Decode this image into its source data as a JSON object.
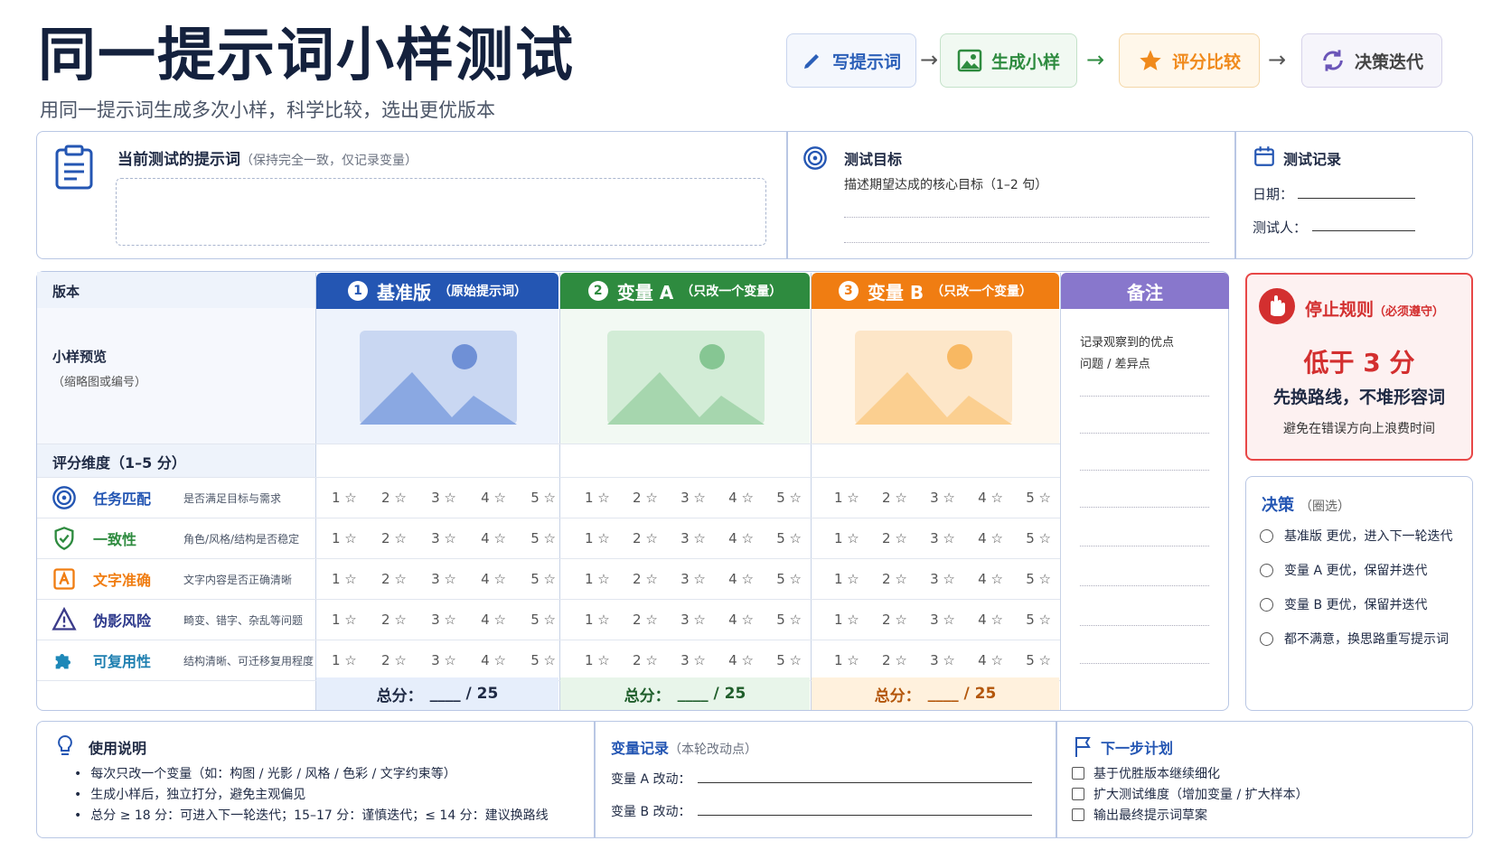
{
  "header": {
    "title": "同一提示词小样测试",
    "subtitle": "用同一提示词生成多次小样，科学比较，选出更优版本",
    "steps": [
      {
        "label": "写提示词",
        "icon": "pencil-icon",
        "color": "#2b5fb8"
      },
      {
        "label": "生成小样",
        "icon": "image-icon",
        "color": "#2e8b3f"
      },
      {
        "label": "评分比较",
        "icon": "star-icon",
        "color": "#f08a1c"
      },
      {
        "label": "决策迭代",
        "icon": "refresh-icon",
        "color": "#6b55b8"
      }
    ],
    "arrow": "→"
  },
  "prompt_box": {
    "title": "当前测试的提示词",
    "hint": "（保持完全一致，仅记录变量）"
  },
  "goal_box": {
    "title": "测试目标",
    "desc": "描述期望达成的核心目标（1–2 句）"
  },
  "record_box": {
    "title": "测试记录",
    "date_label": "日期：",
    "tester_label": "测试人："
  },
  "table": {
    "version_label": "版本",
    "preview_label": "小样预览",
    "preview_hint": "（缩略图或编号）",
    "score_dim_label": "评分维度（1–5 分）",
    "columns": [
      {
        "num": "1",
        "name": "基准版",
        "note": "（原始提示词）",
        "color": "#2456b3"
      },
      {
        "num": "2",
        "name": "变量 A",
        "note": "（只改一个变量）",
        "color": "#2e8b3f"
      },
      {
        "num": "3",
        "name": "变量 B",
        "note": "（只改一个变量）",
        "color": "#f07d12"
      }
    ],
    "notes_header": "备注",
    "notes_text1": "记录观察到的优点",
    "notes_text2": "问题 / 差异点",
    "criteria": [
      {
        "name": "任务匹配",
        "desc": "是否满足目标与需求",
        "icon": "target-icon"
      },
      {
        "name": "一致性",
        "desc": "角色/风格/结构是否稳定",
        "icon": "shield-check-icon"
      },
      {
        "name": "文字准确",
        "desc": "文字内容是否正确清晰",
        "icon": "text-box-icon"
      },
      {
        "name": "伪影风险",
        "desc": "畸变、错字、杂乱等问题",
        "icon": "warning-icon"
      },
      {
        "name": "可复用性",
        "desc": "结构清晰、可迁移复用程度",
        "icon": "puzzle-icon"
      }
    ],
    "star_options": [
      "1 ☆",
      "2 ☆",
      "3 ☆",
      "4 ☆",
      "5 ☆"
    ],
    "total_label": "总分：",
    "total_suffix": "____ / 25"
  },
  "stop_rule": {
    "title": "停止规则",
    "title_note": "（必须遵守）",
    "line1": "低于 3 分",
    "line2": "先换路线，不堆形容词",
    "line3": "避免在错误方向上浪费时间"
  },
  "decision": {
    "title": "决策",
    "title_note": "（圈选）",
    "options": [
      "基准版 更优，进入下一轮迭代",
      "变量 A 更优，保留并迭代",
      "变量 B 更优，保留并迭代",
      "都不满意，换思路重写提示词"
    ]
  },
  "usage": {
    "title": "使用说明",
    "items": [
      "每次只改一个变量（如：构图 / 光影 / 风格 / 色彩 / 文字约束等）",
      "生成小样后，独立打分，避免主观偏见",
      "总分 ≥ 18 分：可进入下一轮迭代；15–17 分：谨慎迭代；≤ 14 分：建议换路线"
    ],
    "bullet": "•"
  },
  "variables": {
    "title": "变量记录",
    "title_note": "（本轮改动点）",
    "a_label": "变量 A 改动：",
    "b_label": "变量 B 改动："
  },
  "next_plan": {
    "title": "下一步计划",
    "items": [
      "基于优胜版本继续细化",
      "扩大测试维度（增加变量 / 扩大样本）",
      "输出最终提示词草案"
    ]
  }
}
